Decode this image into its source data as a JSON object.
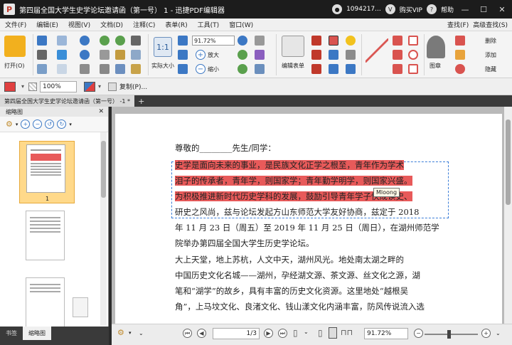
{
  "title_bar": {
    "window_title": "第四届全国大学生史学论坛邀请函（第一号） 1 - 迅捷PDF编辑器",
    "account_id": "1094217...",
    "buy_vip": "购买VIP",
    "help": "帮助"
  },
  "menu": {
    "items": [
      "文件(F)",
      "编辑(E)",
      "视图(V)",
      "文档(D)",
      "注释(C)",
      "表单(R)",
      "工具(T)",
      "窗口(W)"
    ],
    "find": "查找(F)",
    "advanced_find": "高级查找(S)"
  },
  "ribbon": {
    "open_label": "打开(O)",
    "zoom_value": "91.72%",
    "actual_size_label": "实际大小",
    "zoom_in_label": "放大",
    "zoom_out_label": "缩小",
    "edit_form_label": "编辑表单",
    "stamp_label": "图章",
    "comment_labels": [
      "删除",
      "添加",
      "隐藏"
    ]
  },
  "properties_bar": {
    "opacity_value": "100%",
    "duplicate_label": "复制(P)..."
  },
  "tabs": {
    "doc_tab": "第四届全国大学生史学论坛邀请函（第一号） -1 *"
  },
  "sidebar": {
    "title": "缩略图",
    "selected_page_label": "1",
    "bottom_tabs": [
      "书签",
      "缩略图"
    ]
  },
  "document": {
    "salutation": "尊敬的________先生/同学：",
    "lines": [
      "史学是面向未来的事业，是民族文化正学之根至，青年作为学术",
      "泪子的传承者，青年学，则国家学；青年勤学明学，则国家兴盛。",
      "为积极推进新时代历史学科的发展，鼓励引导青年学子快成读史、",
      "研史之风尚，兹与论坛发起方山东师范大学友好协商，兹定于 2018",
      "年 11 月 23 日（周五）至 2019 年 11 月 25 日（周日），在湖州师范学",
      "院举办第四届全国大学生历史学论坛。",
      "大上天堂，地上苏杭，人文中天，湖州风光。地处南太湖之畔的",
      "中国历史文化名城——湖州，孕经湖文源、茶文源、丝文化之源，湖",
      "笔和“湖学”的故乡，具有丰富的历史文化资源。这里地处“越根吴",
      "角”，上马坟文化、良渚文化、钱山漾文化内涵丰富，防风传说流入选"
    ],
    "tooltip_author": "Mloong"
  },
  "status_bar": {
    "page_indicator": "1/3",
    "zoom_value": "91.72%"
  }
}
